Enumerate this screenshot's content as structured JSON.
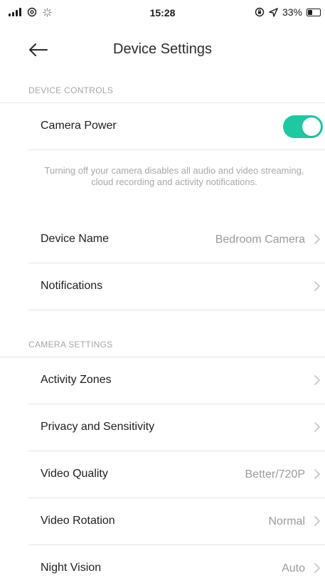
{
  "status_bar": {
    "time": "15:28",
    "battery_text": "33%",
    "battery_level": 0.33
  },
  "nav": {
    "title": "Device Settings"
  },
  "device_controls": {
    "header": "DEVICE CONTROLS",
    "camera_power": {
      "label": "Camera Power",
      "enabled": true
    },
    "hint": "Turning off your camera disables all audio and video streaming, cloud recording and activity notifications.",
    "device_name": {
      "label": "Device Name",
      "value": "Bedroom Camera"
    },
    "notifications": {
      "label": "Notifications"
    }
  },
  "camera_settings": {
    "header": "CAMERA SETTINGS",
    "activity_zones": {
      "label": "Activity Zones"
    },
    "privacy": {
      "label": "Privacy and Sensitivity"
    },
    "video_quality": {
      "label": "Video Quality",
      "value": "Better/720P"
    },
    "video_rotation": {
      "label": "Video Rotation",
      "value": "Normal"
    },
    "night_vision": {
      "label": "Night Vision",
      "value": "Auto"
    }
  },
  "colors": {
    "accent": "#1ec8a3",
    "divider": "#e4e4e6",
    "secondary_text": "#9a9aa0"
  }
}
